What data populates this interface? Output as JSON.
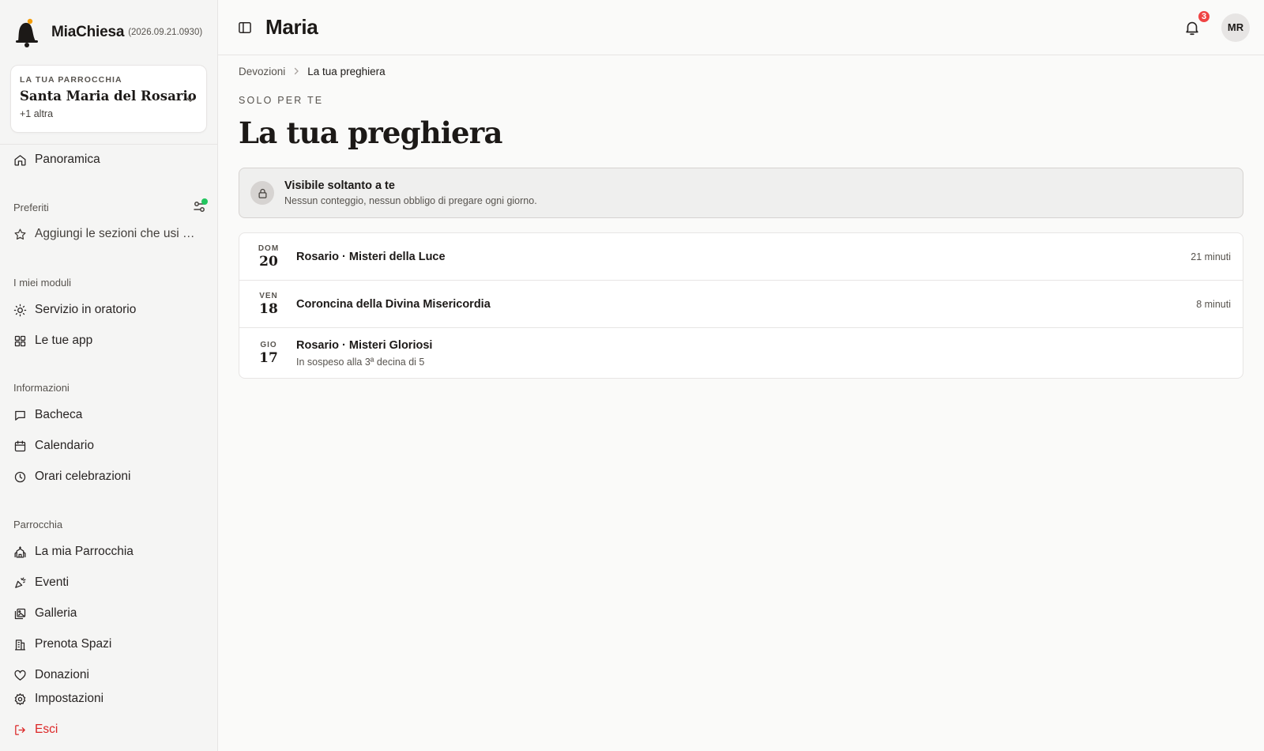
{
  "sidebar": {
    "brand_name": "MiaChiesa",
    "brand_version": "(2026.09.21.0930)",
    "parish": {
      "kicker": "LA TUA PARROCCHIA",
      "name": "Santa Maria del Rosario",
      "more": "+1 altra"
    },
    "overview_label": "Panoramica",
    "favorites": {
      "label": "Preferiti",
      "add_hint": "Aggiungi le sezioni che usi di più"
    },
    "modules": {
      "label": "I miei moduli",
      "items": [
        "Servizio in oratorio",
        "Le tue app"
      ]
    },
    "info": {
      "label": "Informazioni",
      "items": [
        "Bacheca",
        "Calendario",
        "Orari celebrazioni"
      ]
    },
    "parish_section": {
      "label": "Parrocchia",
      "items": [
        "La mia Parrocchia",
        "Eventi",
        "Galleria",
        "Prenota Spazi",
        "Donazioni"
      ]
    },
    "settings_label": "Impostazioni",
    "logout_label": "Esci"
  },
  "topbar": {
    "user_name": "Maria",
    "notifications_count": "3",
    "avatar_initials": "MR"
  },
  "breadcrumb": {
    "parent": "Devozioni",
    "current": "La tua preghiera"
  },
  "page": {
    "kicker": "SOLO PER TE",
    "title": "La tua preghiera"
  },
  "privacy": {
    "title": "Visibile soltanto a te",
    "subtitle": "Nessun conteggio, nessun obbligo di pregare ogni giorno."
  },
  "sessions": [
    {
      "dow": "DOM",
      "day": "20",
      "title": "Rosario · Misteri della Luce",
      "subtitle": "",
      "duration": "21 minuti"
    },
    {
      "dow": "VEN",
      "day": "18",
      "title": "Coroncina della Divina Misericordia",
      "subtitle": "",
      "duration": "8 minuti"
    },
    {
      "dow": "GIO",
      "day": "17",
      "title": "Rosario · Misteri Gloriosi",
      "subtitle": "In sospeso alla 3ª decina di 5",
      "duration": ""
    }
  ],
  "colors": {
    "sidebar_bg": "#f5f5f4",
    "page_bg": "#fafaf9",
    "accent_green": "#22c55e",
    "badge_red": "#ef4444",
    "logout_red": "#dc2626",
    "logo_orange": "#f59e0b"
  }
}
